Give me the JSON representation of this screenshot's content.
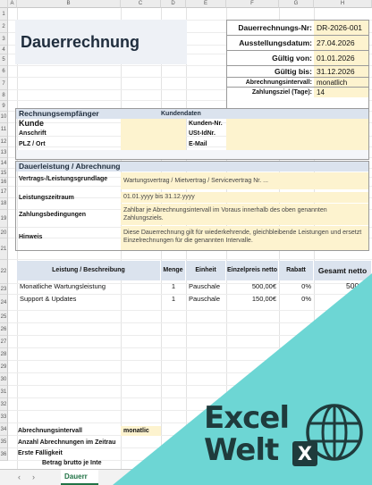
{
  "columns": [
    "A",
    "B",
    "C",
    "D",
    "E",
    "F",
    "G",
    "H"
  ],
  "rows": [
    "1",
    "2",
    "3",
    "4",
    "5",
    "6",
    "7",
    "8",
    "9",
    "10",
    "11",
    "12",
    "13",
    "14",
    "15",
    "16",
    "17",
    "18",
    "19",
    "20",
    "21",
    "22",
    "23",
    "24",
    "25",
    "26",
    "27",
    "28",
    "29",
    "30",
    "31",
    "32",
    "33",
    "34",
    "35",
    "36"
  ],
  "title": "Dauerrechnung",
  "meta": [
    {
      "label": "Dauerrechnungs-Nr:",
      "value": "DR-2026-001"
    },
    {
      "label": "Ausstellungsdatum:",
      "value": "27.04.2026"
    },
    {
      "label": "Gültig von:",
      "value": "01.01.2026"
    },
    {
      "label": "Gültig bis:",
      "value": "31.12.2026"
    },
    {
      "label": "Abrechnungsintervall:",
      "value": "monatlich"
    },
    {
      "label": "Zahlungsziel (Tage):",
      "value": "14"
    }
  ],
  "recipient": {
    "section": "Rechnungsempfänger",
    "customer_data": "Kundendaten",
    "customer": "Kunde",
    "address": "Anschrift",
    "zip_city": "PLZ / Ort",
    "customer_no": "Kunden-Nr.",
    "vat_id": "USt-IdNr.",
    "email": "E-Mail"
  },
  "service": {
    "section": "Dauerleistung / Abrechnung",
    "contract_label": "Vertrags-/Leistungsgrundlage",
    "contract_value": "Wartungsvertrag / Mietvertrag / Servicevertrag Nr. ...",
    "period_label": "Leistungszeitraum",
    "period_value": "01.01.yyyy bis 31.12.yyyy",
    "payment_label": "Zahlungsbedingungen",
    "payment_value": "Zahlbar je Abrechnungsintervall im Voraus innerhalb des oben genannten Zahlungsziels.",
    "note_label": "Hinweis",
    "note_value": "Diese Dauerrechnung gilt für wiederkehrende, gleichbleibende Leistungen und ersetzt Einzelrechnungen für die genannten Intervalle."
  },
  "table": {
    "headers": {
      "description": "Leistung / Beschreibung",
      "qty": "Menge",
      "unit": "Einheit",
      "unit_price": "Einzelpreis netto",
      "discount": "Rabatt",
      "total": "Gesamt netto"
    },
    "rows": [
      {
        "description": "Monatliche Wartungsleistung",
        "qty": "1",
        "unit": "Pauschale",
        "unit_price": "500,00€",
        "discount": "0%",
        "total": "500,00"
      },
      {
        "description": "Support & Updates",
        "qty": "1",
        "unit": "Pauschale",
        "unit_price": "150,00€",
        "discount": "0%",
        "total": "15"
      }
    ]
  },
  "summary": {
    "interval_label": "Abrechnungsintervall",
    "interval_value": "monatlic",
    "count_label": "Anzahl Abrechnungen im Zeitrau",
    "first_due_label": "Erste Fälligkeit",
    "gross_label": "Betrag brutto je Inte"
  },
  "sheet_tab": "Dauerr",
  "nav": {
    "prev": "‹",
    "next": "›"
  },
  "logo": {
    "line1": "Excel",
    "line2": "Welt",
    "badge": "X"
  },
  "colors": {
    "accent_teal": "#6dd6d4",
    "header_blue": "#dbe3ee",
    "input_yellow": "#fdf3cf",
    "excel_green": "#217346"
  }
}
